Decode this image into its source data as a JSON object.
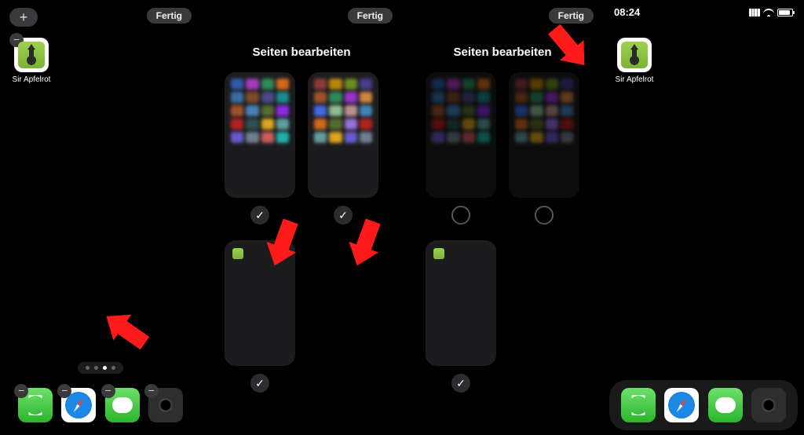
{
  "buttons": {
    "plus": "+",
    "done": "Fertig",
    "remove": "−"
  },
  "app": {
    "label": "Sir Apfelrot"
  },
  "editPages": {
    "title": "Seiten bearbeiten"
  },
  "statusbar": {
    "time": "08:24"
  },
  "checks": {
    "checked": "✓"
  },
  "dock": {
    "apps": [
      "phone",
      "safari",
      "messages",
      "camera"
    ]
  },
  "pageDots": {
    "count": 4,
    "active": 2
  },
  "thumbColors": {
    "a": [
      "#2e5aac",
      "#a43ab5",
      "#2e8b57",
      "#d06a1a",
      "#3a6ea5",
      "#7b4b2a",
      "#4a4a8a",
      "#1a8a8a",
      "#a0522d",
      "#4682b4",
      "#556b2f",
      "#8a2be2",
      "#b22222",
      "#2f4f4f",
      "#daa520",
      "#5f9ea0",
      "#6a5acd",
      "#708090",
      "#cd5c5c",
      "#20b2aa"
    ],
    "b": [
      "#8b3a3a",
      "#b8860b",
      "#6b8e23",
      "#483d8b",
      "#a0522d",
      "#2e8b57",
      "#9932cc",
      "#cd853f",
      "#4169e1",
      "#8fbc8f",
      "#bc8f8f",
      "#4682b4",
      "#d2691e",
      "#556b2f",
      "#9370db",
      "#b22222",
      "#5f9ea0",
      "#daa520",
      "#6a5acd",
      "#708090"
    ]
  }
}
